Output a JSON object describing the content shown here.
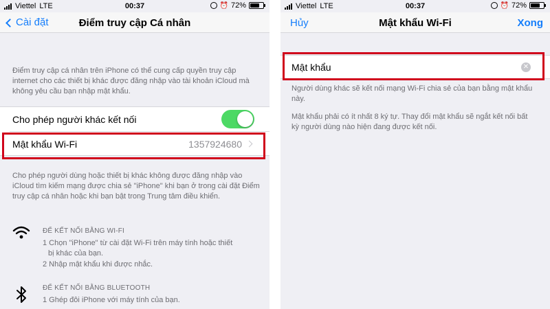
{
  "left": {
    "status": {
      "carrier": "Viettel",
      "network": "LTE",
      "time": "00:37",
      "battery": "72%",
      "battery_level": 0.72
    },
    "nav": {
      "back_label": "Cài đặt",
      "title": "Điểm truy cập Cá nhân"
    },
    "intro_text": "Điểm truy cập cá nhân trên iPhone có thể cung cấp quyền truy cập internet cho các thiết bị khác được đăng nhập vào tài khoản iCloud mà không yêu cầu bạn nhập mật khẩu.",
    "allow_others": {
      "label": "Cho phép người khác kết nối",
      "enabled": true
    },
    "wifi_password": {
      "label": "Mật khẩu Wi-Fi",
      "value": "1357924680"
    },
    "description": "Cho phép người dùng hoặc thiết bị khác không được đăng nhập vào iCloud tìm kiếm mạng được chia sẻ \"iPhone\" khi bạn ở trong cài đặt Điểm truy cập cá nhân hoặc khi bạn bật trong Trung tâm điều khiển.",
    "wifi_section": {
      "heading": "ĐỂ KẾT NỐI BẰNG WI-FI",
      "step1a": "1 Chọn \"iPhone\" từ cài đặt Wi-Fi trên máy tính hoặc thiết",
      "step1b": "bị khác của bạn.",
      "step2": "2 Nhập mật khẩu khi được nhắc."
    },
    "bluetooth_section": {
      "heading": "ĐỂ KẾT NỐI BẰNG BLUETOOTH",
      "step1": "1 Ghép đôi iPhone với máy tính của bạn."
    }
  },
  "right": {
    "status": {
      "carrier": "Viettel",
      "network": "LTE",
      "time": "00:37",
      "battery": "72%",
      "battery_level": 0.72
    },
    "nav": {
      "cancel_label": "Hủy",
      "title": "Mật khẩu Wi-Fi",
      "done_label": "Xong"
    },
    "password_field": {
      "placeholder": "Mật khẩu"
    },
    "note1": "Người dùng khác sẽ kết nối mạng Wi-Fi chia sẻ của bạn bằng mật khẩu này.",
    "note2": "Mật khẩu phải có ít nhất 8 ký tự. Thay đổi mật khẩu sẽ ngắt kết nối bất kỳ người dùng nào hiện đang được kết nối."
  },
  "colors": {
    "accent": "#157efb",
    "toggle_on": "#4cd964",
    "highlight": "#d0021b",
    "background": "#efeff4"
  }
}
